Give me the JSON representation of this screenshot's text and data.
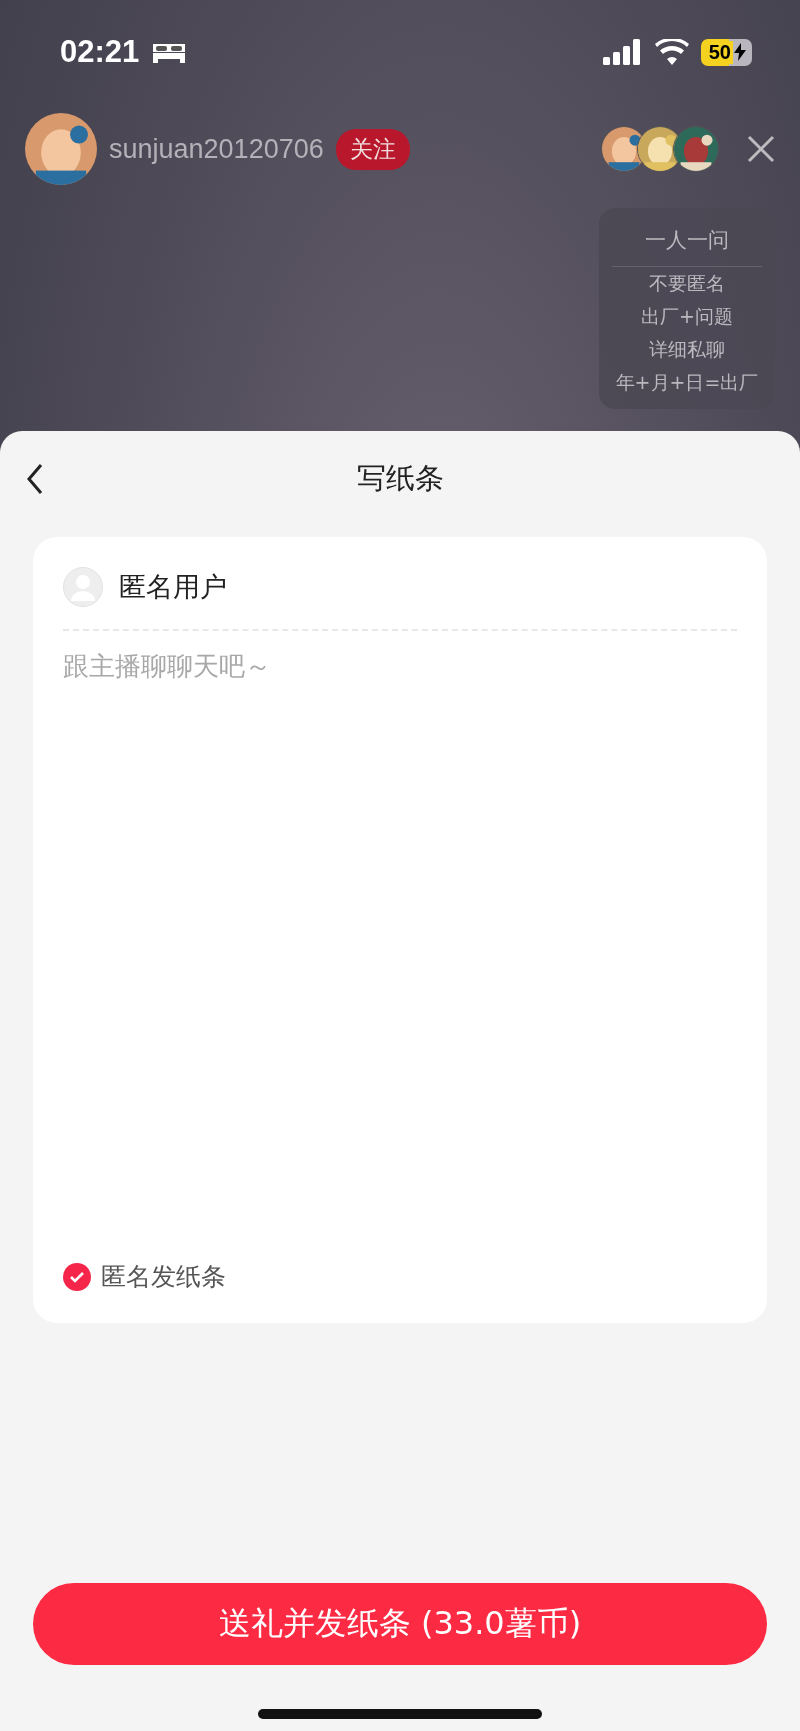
{
  "status_bar": {
    "time": "02:21",
    "battery": "50"
  },
  "streamer": {
    "name": "sunjuan20120706",
    "follow_label": "关注",
    "followed": false
  },
  "notice": {
    "title": "一人一问",
    "lines": [
      "不要匿名",
      "出厂+问题",
      "详细私聊",
      "年+月+日=出厂"
    ]
  },
  "sheet": {
    "title": "写纸条",
    "card": {
      "user_name": "匿名用户",
      "placeholder": "跟主播聊聊天吧～",
      "anonymous": {
        "label": "匿名发纸条",
        "checked": true
      }
    },
    "submit_button": "送礼并发纸条 (33.0薯币)"
  }
}
